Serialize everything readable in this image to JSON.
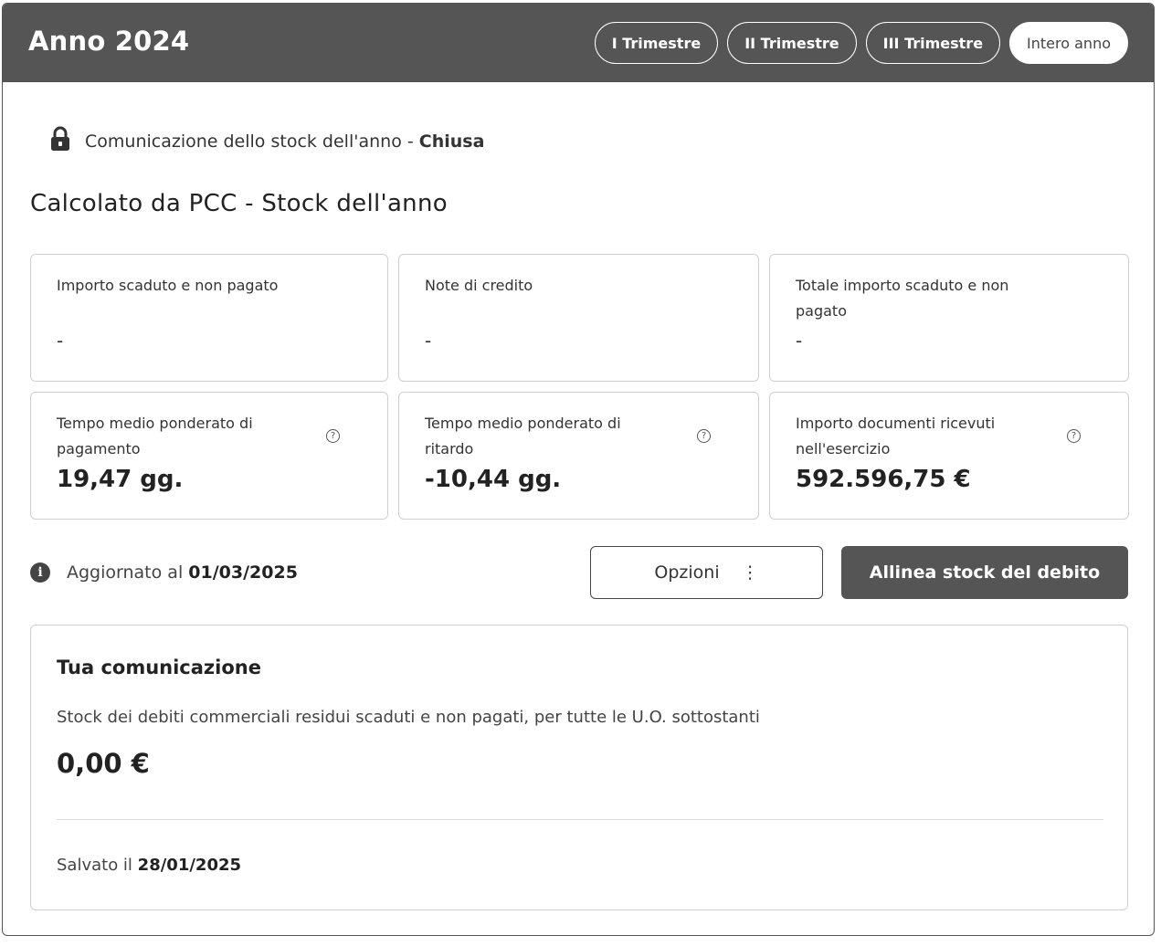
{
  "header": {
    "title": "Anno 2024",
    "tabs": [
      {
        "label": "I Trimestre",
        "active": false
      },
      {
        "label": "II Trimestre",
        "active": false
      },
      {
        "label": "III Trimestre",
        "active": false
      },
      {
        "label": "Intero anno",
        "active": true
      }
    ]
  },
  "status": {
    "icon": "lock-icon",
    "text": "Comunicazione dello stock dell'anno -",
    "state": "Chiusa"
  },
  "section": {
    "title": "Calcolato da PCC - Stock dell'anno"
  },
  "cards": [
    {
      "label": "Importo scaduto e non pagato",
      "value": "-"
    },
    {
      "label": "Note di credito",
      "value": "-"
    },
    {
      "label": "Totale importo scaduto e non pagato",
      "value": "-"
    },
    {
      "label": "Tempo medio ponderato di pagamento",
      "value": "19,47 gg.",
      "help": "?"
    },
    {
      "label": "Tempo medio ponderato di ritardo",
      "value": "-10,44 gg.",
      "help": "?"
    },
    {
      "label": "Importo documenti ricevuti nell'esercizio",
      "value": "592.596,75 €",
      "help": "?"
    }
  ],
  "update": {
    "icon_glyph": "i",
    "prefix": "Aggiornato al",
    "date": "01/03/2025"
  },
  "actions": {
    "options_label": "Opzioni",
    "options_glyph": "⋮",
    "primary_label": "Allinea stock del debito"
  },
  "communication": {
    "title": "Tua comunicazione",
    "description": "Stock dei debiti commerciali residui scaduti e non pagati, per tutte le U.O. sottostanti",
    "value": "0,00 €",
    "saved_prefix": "Salvato il",
    "saved_date": "28/01/2025"
  },
  "colors": {
    "header_bg": "#555555",
    "primary_button_bg": "#555555"
  }
}
